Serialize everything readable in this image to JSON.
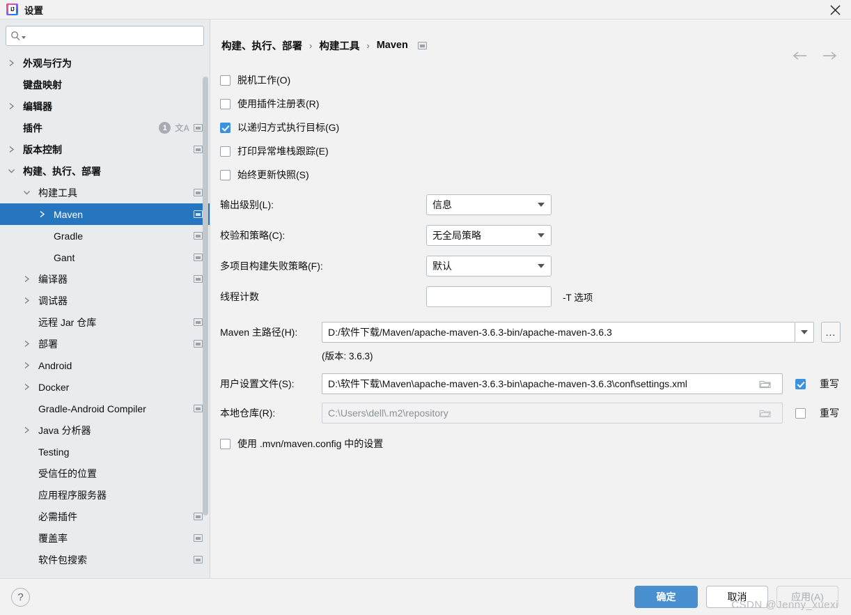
{
  "window": {
    "title": "设置",
    "app_icon": "intellij-idea-icon",
    "close_icon": "close-icon"
  },
  "sidebar": {
    "search": {
      "placeholder": "",
      "value": "",
      "icon": "search-icon"
    },
    "items": [
      {
        "label": "外观与行为",
        "indent": 0,
        "arrow": "right",
        "bold": true,
        "selected": false,
        "badge": null,
        "lang": false,
        "mini": false
      },
      {
        "label": "键盘映射",
        "indent": 0,
        "arrow": "none",
        "bold": true,
        "selected": false,
        "badge": null,
        "lang": false,
        "mini": false
      },
      {
        "label": "编辑器",
        "indent": 0,
        "arrow": "right",
        "bold": true,
        "selected": false,
        "badge": null,
        "lang": false,
        "mini": false
      },
      {
        "label": "插件",
        "indent": 0,
        "arrow": "none",
        "bold": true,
        "selected": false,
        "badge": "1",
        "lang": true,
        "mini": true
      },
      {
        "label": "版本控制",
        "indent": 0,
        "arrow": "right",
        "bold": true,
        "selected": false,
        "badge": null,
        "lang": false,
        "mini": true
      },
      {
        "label": "构建、执行、部署",
        "indent": 0,
        "arrow": "down",
        "bold": true,
        "selected": false,
        "badge": null,
        "lang": false,
        "mini": false
      },
      {
        "label": "构建工具",
        "indent": 1,
        "arrow": "down",
        "bold": false,
        "selected": false,
        "badge": null,
        "lang": false,
        "mini": true
      },
      {
        "label": "Maven",
        "indent": 2,
        "arrow": "right",
        "bold": false,
        "selected": true,
        "badge": null,
        "lang": false,
        "mini": true
      },
      {
        "label": "Gradle",
        "indent": 2,
        "arrow": "none",
        "bold": false,
        "selected": false,
        "badge": null,
        "lang": false,
        "mini": true
      },
      {
        "label": "Gant",
        "indent": 2,
        "arrow": "none",
        "bold": false,
        "selected": false,
        "badge": null,
        "lang": false,
        "mini": true
      },
      {
        "label": "编译器",
        "indent": 1,
        "arrow": "right",
        "bold": false,
        "selected": false,
        "badge": null,
        "lang": false,
        "mini": true
      },
      {
        "label": "调试器",
        "indent": 1,
        "arrow": "right",
        "bold": false,
        "selected": false,
        "badge": null,
        "lang": false,
        "mini": false
      },
      {
        "label": "远程 Jar 仓库",
        "indent": 1,
        "arrow": "none",
        "bold": false,
        "selected": false,
        "badge": null,
        "lang": false,
        "mini": true
      },
      {
        "label": "部署",
        "indent": 1,
        "arrow": "right",
        "bold": false,
        "selected": false,
        "badge": null,
        "lang": false,
        "mini": true
      },
      {
        "label": "Android",
        "indent": 1,
        "arrow": "right",
        "bold": false,
        "selected": false,
        "badge": null,
        "lang": false,
        "mini": false
      },
      {
        "label": "Docker",
        "indent": 1,
        "arrow": "right",
        "bold": false,
        "selected": false,
        "badge": null,
        "lang": false,
        "mini": false
      },
      {
        "label": "Gradle-Android Compiler",
        "indent": 1,
        "arrow": "none",
        "bold": false,
        "selected": false,
        "badge": null,
        "lang": false,
        "mini": true
      },
      {
        "label": "Java 分析器",
        "indent": 1,
        "arrow": "right",
        "bold": false,
        "selected": false,
        "badge": null,
        "lang": false,
        "mini": false
      },
      {
        "label": "Testing",
        "indent": 1,
        "arrow": "none",
        "bold": false,
        "selected": false,
        "badge": null,
        "lang": false,
        "mini": false
      },
      {
        "label": "受信任的位置",
        "indent": 1,
        "arrow": "none",
        "bold": false,
        "selected": false,
        "badge": null,
        "lang": false,
        "mini": false
      },
      {
        "label": "应用程序服务器",
        "indent": 1,
        "arrow": "none",
        "bold": false,
        "selected": false,
        "badge": null,
        "lang": false,
        "mini": false
      },
      {
        "label": "必需插件",
        "indent": 1,
        "arrow": "none",
        "bold": false,
        "selected": false,
        "badge": null,
        "lang": false,
        "mini": true
      },
      {
        "label": "覆盖率",
        "indent": 1,
        "arrow": "none",
        "bold": false,
        "selected": false,
        "badge": null,
        "lang": false,
        "mini": true
      },
      {
        "label": "软件包搜索",
        "indent": 1,
        "arrow": "none",
        "bold": false,
        "selected": false,
        "badge": null,
        "lang": false,
        "mini": true
      }
    ]
  },
  "main": {
    "breadcrumb": {
      "parts": [
        "构建、执行、部署",
        "构建工具",
        "Maven"
      ],
      "separator": "›",
      "trailing_icon": "settings-sync-icon"
    },
    "nav": {
      "back_icon": "arrow-left-icon",
      "forward_icon": "arrow-right-icon"
    },
    "checkboxes": [
      {
        "label": "脱机工作(O)",
        "checked": false
      },
      {
        "label": "使用插件注册表(R)",
        "checked": false
      },
      {
        "label": "以递归方式执行目标(G)",
        "checked": true
      },
      {
        "label": "打印异常堆栈跟踪(E)",
        "checked": false
      },
      {
        "label": "始终更新快照(S)",
        "checked": false
      }
    ],
    "fields": [
      {
        "label": "输出级别(L):",
        "type": "combo",
        "value": "信息"
      },
      {
        "label": "校验和策略(C):",
        "type": "combo",
        "value": "无全局策略"
      },
      {
        "label": "多项目构建失败策略(F):",
        "type": "combo",
        "value": "默认"
      },
      {
        "label": "线程计数",
        "type": "text",
        "value": "",
        "suffix": "-T 选项"
      }
    ],
    "maven_home": {
      "label": "Maven 主路径(H):",
      "value": "D:/软件下载/Maven/apache-maven-3.6.3-bin/apache-maven-3.6.3",
      "dropdown_icon": "chevron-down-icon",
      "browse_label": "...",
      "version_note": "(版本: 3.6.3)"
    },
    "user_settings": {
      "label": "用户设置文件(S):",
      "value": "D:\\软件下载\\Maven\\apache-maven-3.6.3-bin\\apache-maven-3.6.3\\conf\\settings.xml",
      "browse_icon": "folder-icon",
      "override_label": "重写",
      "override_checked": true
    },
    "local_repo": {
      "label": "本地仓库(R):",
      "value": "C:\\Users\\dell\\.m2\\repository",
      "browse_icon": "folder-icon",
      "override_label": "重写",
      "override_checked": false
    },
    "mvn_config": {
      "label": "使用 .mvn/maven.config 中的设置",
      "checked": false
    }
  },
  "footer": {
    "help_label": "?",
    "ok_label": "确定",
    "cancel_label": "取消",
    "apply_label": "应用(A)",
    "watermark": "CSDN @Jenny_xuexi"
  },
  "colors": {
    "accent": "#2675bf",
    "primary_button": "#4a8fd0",
    "checkbox_checked": "#3b90e0",
    "sidebar_bg": "#e8ecef",
    "panel_bg": "#f2f2f2"
  }
}
